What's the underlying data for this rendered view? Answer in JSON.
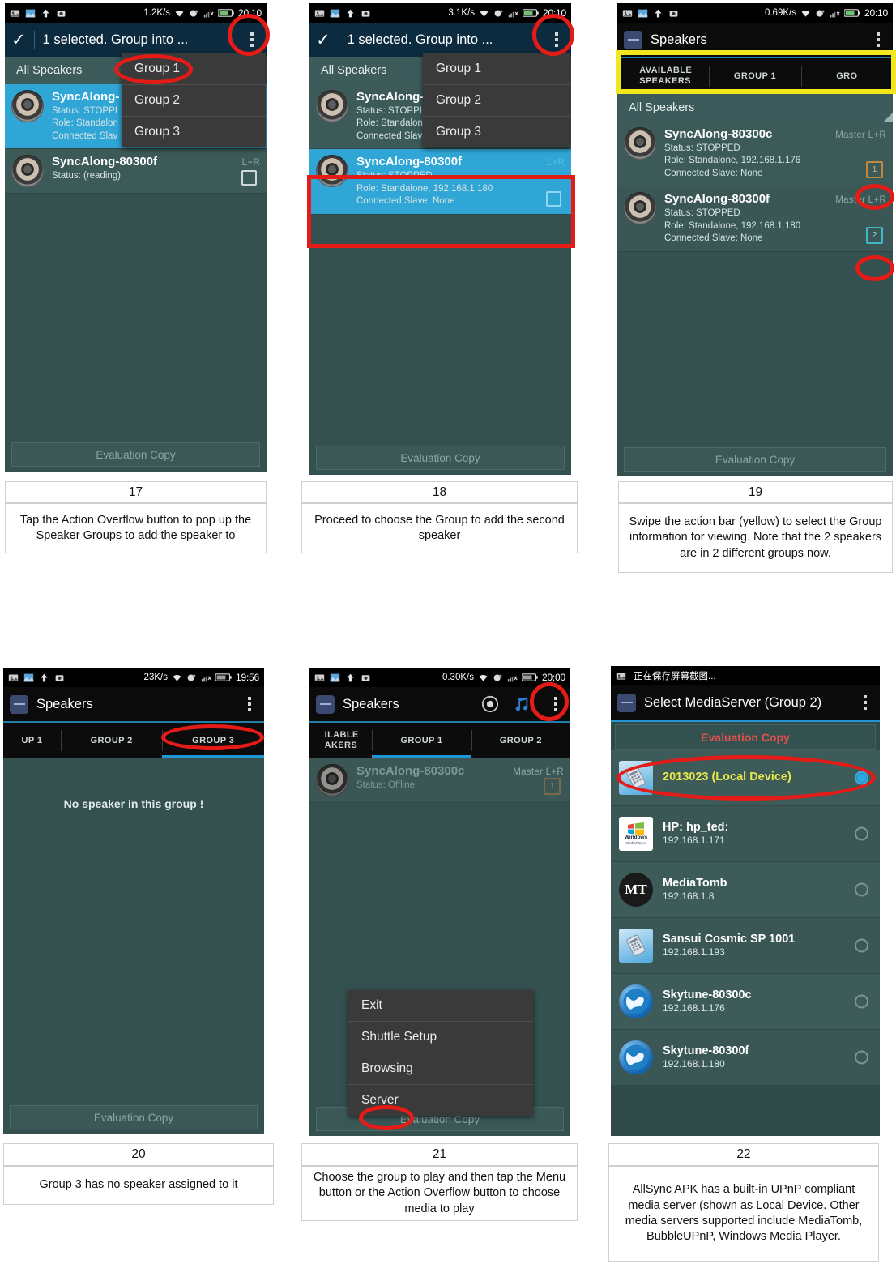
{
  "panels": [
    {
      "id": 17,
      "status": {
        "rate": "1.2K/s",
        "time": "20:10",
        "battery": ""
      },
      "actionbar": {
        "title": "1 selected. Group into ...",
        "check_icon": "check-icon",
        "overflow_icon": "overflow-menu-icon"
      },
      "list_header": "All Speakers",
      "speakers": [
        {
          "name": "SyncAlong-",
          "status": "Status: STOPPI",
          "role": "Role: Standalon",
          "slave": "Connected Slav",
          "badge": "",
          "lr": ""
        },
        {
          "name": "SyncAlong-80300f",
          "status": "Status: (reading)",
          "role": "",
          "slave": "",
          "badge": "",
          "lr": "L+R"
        }
      ],
      "dropdown": [
        "Group 1",
        "Group 2",
        "Group 3"
      ],
      "footer": "Evaluation Copy",
      "caption_num": "17",
      "caption_text": "Tap the Action Overflow button to pop up the Speaker Groups to add the speaker to"
    },
    {
      "id": 18,
      "status": {
        "rate": "3.1K/s",
        "time": "20:10"
      },
      "actionbar": {
        "title": "1 selected. Group into ...",
        "check_icon": "check-icon",
        "overflow_icon": "overflow-menu-icon"
      },
      "list_header": "All Speakers",
      "speakers": [
        {
          "name": "SyncAlong-",
          "status": "Status: STOPPI",
          "role": "Role: Standalon",
          "slave": "Connected Slav",
          "lr": ""
        },
        {
          "name": "SyncAlong-80300f",
          "status": "Status: STOPPED",
          "role": "Role: Standalone,  192.168.1.180",
          "slave": "Connected Slave: None",
          "lr": "L+R"
        }
      ],
      "dropdown": [
        "Group 1",
        "Group 2",
        "Group 3"
      ],
      "footer": "Evaluation Copy",
      "caption_num": "18",
      "caption_text": "Proceed to choose the Group to add the second speaker"
    },
    {
      "id": 19,
      "status": {
        "rate": "0.69K/s",
        "time": "20:10"
      },
      "actionbar": {
        "title": "Speakers",
        "overflow_icon": "overflow-menu-icon",
        "logo_icon": "app-logo-icon"
      },
      "tabs": [
        "AVAILABLE SPEAKERS",
        "GROUP 1",
        "GRO"
      ],
      "active_tab": 0,
      "list_header": "All Speakers",
      "speakers": [
        {
          "name": "SyncAlong-80300c",
          "status": "Status: STOPPED",
          "role": "Role: Standalone,  192.168.1.176",
          "slave": "Connected Slave: None",
          "lr": "Master  L+R",
          "badge": "1"
        },
        {
          "name": "SyncAlong-80300f",
          "status": "Status: STOPPED",
          "role": "Role: Standalone,  192.168.1.180",
          "slave": "Connected Slave: None",
          "lr": "Master  L+R",
          "badge": "2"
        }
      ],
      "footer": "Evaluation Copy",
      "caption_num": "19",
      "caption_text": "Swipe the action bar (yellow) to select the Group information for viewing. Note that the 2 speakers are in 2 different groups now."
    },
    {
      "id": 20,
      "status": {
        "rate": "23K/s",
        "time": "19:56"
      },
      "actionbar": {
        "title": "Speakers",
        "overflow_icon": "overflow-menu-icon",
        "logo_icon": "app-logo-icon"
      },
      "tabs": [
        "UP 1",
        "GROUP 2",
        "GROUP 3"
      ],
      "active_tab": 2,
      "empty_message": "No speaker in this group !",
      "footer": "Evaluation Copy",
      "caption_num": "20",
      "caption_text": "Group 3 has no speaker assigned to it"
    },
    {
      "id": 21,
      "status": {
        "rate": "0.30K/s",
        "time": "20:00"
      },
      "actionbar": {
        "title": "Speakers",
        "overflow_icon": "overflow-menu-icon",
        "logo_icon": "app-logo-icon",
        "speaker_icon": "speaker-icon",
        "music_icon": "music-note-icon"
      },
      "tabs": [
        "ILABLE AKERS",
        "GROUP 1",
        "GROUP 2"
      ],
      "active_tab": 1,
      "speakers": [
        {
          "name": "SyncAlong-80300c",
          "status": "Status: Offline",
          "role": "",
          "slave": "",
          "lr": "Master  L+R",
          "badge": "1"
        }
      ],
      "menu": [
        "Exit",
        "Shuttle Setup",
        "Browsing",
        "Server"
      ],
      "footer": "Evaluation Copy",
      "caption_num": "21",
      "caption_text": "Choose the group to play and then tap the Menu button or the Action Overflow button to choose media to play"
    },
    {
      "id": 22,
      "status": {
        "rate": "",
        "time": "",
        "text": "正在保存屏幕截图..."
      },
      "actionbar": {
        "title": "Select MediaServer (Group 2)",
        "overflow_icon": "overflow-menu-icon",
        "logo_icon": "app-logo-icon"
      },
      "eval_banner": "Evaluation Copy",
      "servers": [
        {
          "name": "2013023 (Local Device)",
          "ip": "",
          "selected": true,
          "icon": "tablet-icon",
          "highlight": true
        },
        {
          "name": "HP: hp_ted:",
          "ip": "192.168.1.171",
          "selected": false,
          "icon": "windows-media-player-icon"
        },
        {
          "name": "MediaTomb",
          "ip": "192.168.1.8",
          "selected": false,
          "icon": "mediatomb-icon"
        },
        {
          "name": "Sansui Cosmic SP 1001",
          "ip": "192.168.1.193",
          "selected": false,
          "icon": "tablet-icon"
        },
        {
          "name": "Skytune-80300c",
          "ip": "192.168.1.176",
          "selected": false,
          "icon": "globe-icon"
        },
        {
          "name": "Skytune-80300f",
          "ip": "192.168.1.180",
          "selected": false,
          "icon": "globe-icon"
        }
      ],
      "caption_num": "22",
      "caption_text": "AllSync APK has a built-in UPnP compliant media server (shown as Local Device. Other media servers supported include MediaTomb, BubbleUPnP, Windows Media Player."
    }
  ],
  "colors": {
    "accent_blue": "#2196d4",
    "annotation_red": "#e41b17",
    "annotation_yellow": "#f2e71c",
    "panel_bg": "#34504f",
    "selected_row": "#2fa6d6",
    "eval_red": "#e0504e",
    "local_device_yellow": "#e8e84a"
  }
}
